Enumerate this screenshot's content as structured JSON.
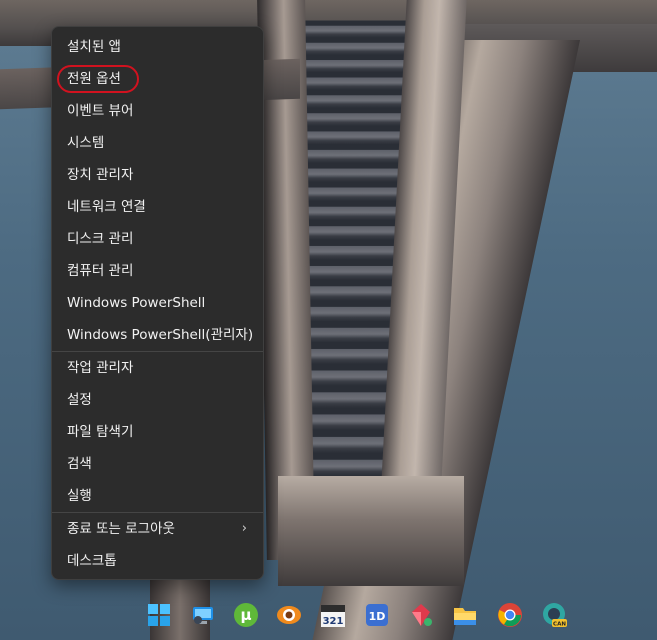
{
  "menu": {
    "items": [
      {
        "label": "설치된 앱"
      },
      {
        "label": "전원 옵션"
      },
      {
        "label": "이벤트 뷰어"
      },
      {
        "label": "시스템"
      },
      {
        "label": "장치 관리자"
      },
      {
        "label": "네트워크 연결"
      },
      {
        "label": "디스크 관리"
      },
      {
        "label": "컴퓨터 관리"
      },
      {
        "label": "Windows PowerShell"
      },
      {
        "label": "Windows PowerShell(관리자)"
      },
      {
        "label": "작업 관리자"
      },
      {
        "label": "설정"
      },
      {
        "label": "파일 탐색기"
      },
      {
        "label": "검색"
      },
      {
        "label": "실행"
      },
      {
        "label": "종료 또는 로그아웃",
        "submenu_glyph": "›"
      },
      {
        "label": "데스크톱"
      }
    ],
    "highlighted_item": "전원 옵션",
    "highlight_color": "#d1121f"
  },
  "taskbar": {
    "icons": [
      {
        "name": "start-icon"
      },
      {
        "name": "remote-desktop-icon"
      },
      {
        "name": "utorrent-icon",
        "glyph": "µ"
      },
      {
        "name": "eye-app-icon"
      },
      {
        "name": "calendar-321-icon",
        "text": "321"
      },
      {
        "name": "media-player-icon",
        "text": "1D"
      },
      {
        "name": "gem-app-icon"
      },
      {
        "name": "file-explorer-icon"
      },
      {
        "name": "chrome-icon"
      },
      {
        "name": "edge-canary-icon",
        "badge": "CAN"
      }
    ]
  },
  "colors": {
    "menu_bg": "#2c2c2c",
    "menu_text": "#f2f2f2"
  }
}
